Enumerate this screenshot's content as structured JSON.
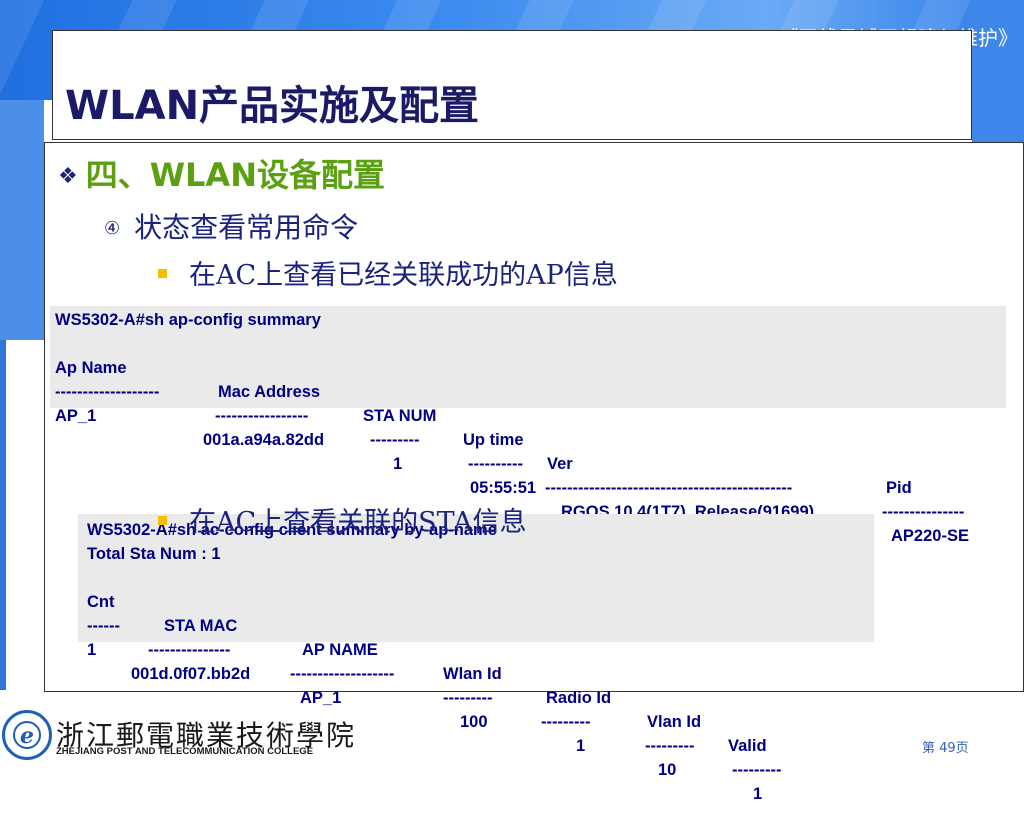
{
  "header": {
    "course_title": "《无线局域网组建与维护》",
    "slide_title": "WLAN产品实施及配置"
  },
  "content": {
    "level1": {
      "bullet": "❖",
      "text": "四、WLAN设备配置"
    },
    "level2": {
      "number": "④",
      "text": "状态查看常用命令"
    },
    "bullet_ap": "在AC上查看已经关联成功的AP信息",
    "bullet_sta": "在AC上查看关联的STA信息"
  },
  "ap_summary": {
    "command": "WS5302-A#sh ap-config summary",
    "headers": [
      "Ap Name",
      "Mac Address",
      "STA NUM",
      "Up time",
      "Ver",
      "Pid"
    ],
    "separators": [
      "-------------------",
      "-----------------",
      "---------",
      "----------",
      "---------------------------------------------",
      "---------------"
    ],
    "row": [
      "AP_1",
      "001a.a94a.82dd",
      "1",
      "05:55:51",
      "RGOS 10.4(1T7), Release(91699)",
      "AP220-SE"
    ]
  },
  "sta_summary": {
    "command": "WS5302-A#sh ac-config client summary by-ap-name",
    "total": "Total Sta Num : 1",
    "headers": [
      "Cnt",
      "STA MAC",
      "AP NAME",
      "Wlan Id",
      "Radio Id",
      "Vlan Id",
      "Valid"
    ],
    "separators": [
      "------",
      "---------------",
      "-------------------",
      "---------",
      "---------",
      "---------",
      "---------"
    ],
    "row": [
      "1",
      "001d.0f07.bb2d",
      "AP_1",
      "100",
      "1",
      "10",
      "1"
    ]
  },
  "footer": {
    "logo_mark": "e",
    "college_cn": "浙江郵電職業技術學院",
    "college_en": "ZHEJIANG POST AND TELECOMMUNICATION COLLEGE",
    "page_number": "第 49页"
  },
  "colors": {
    "title": "#1a1a66",
    "heading_green": "#5aa010",
    "body_navy": "#1a237e",
    "code_navy": "#000080",
    "bullet_yellow": "#f6c000",
    "top_band_blue": "#3d8cf0"
  }
}
